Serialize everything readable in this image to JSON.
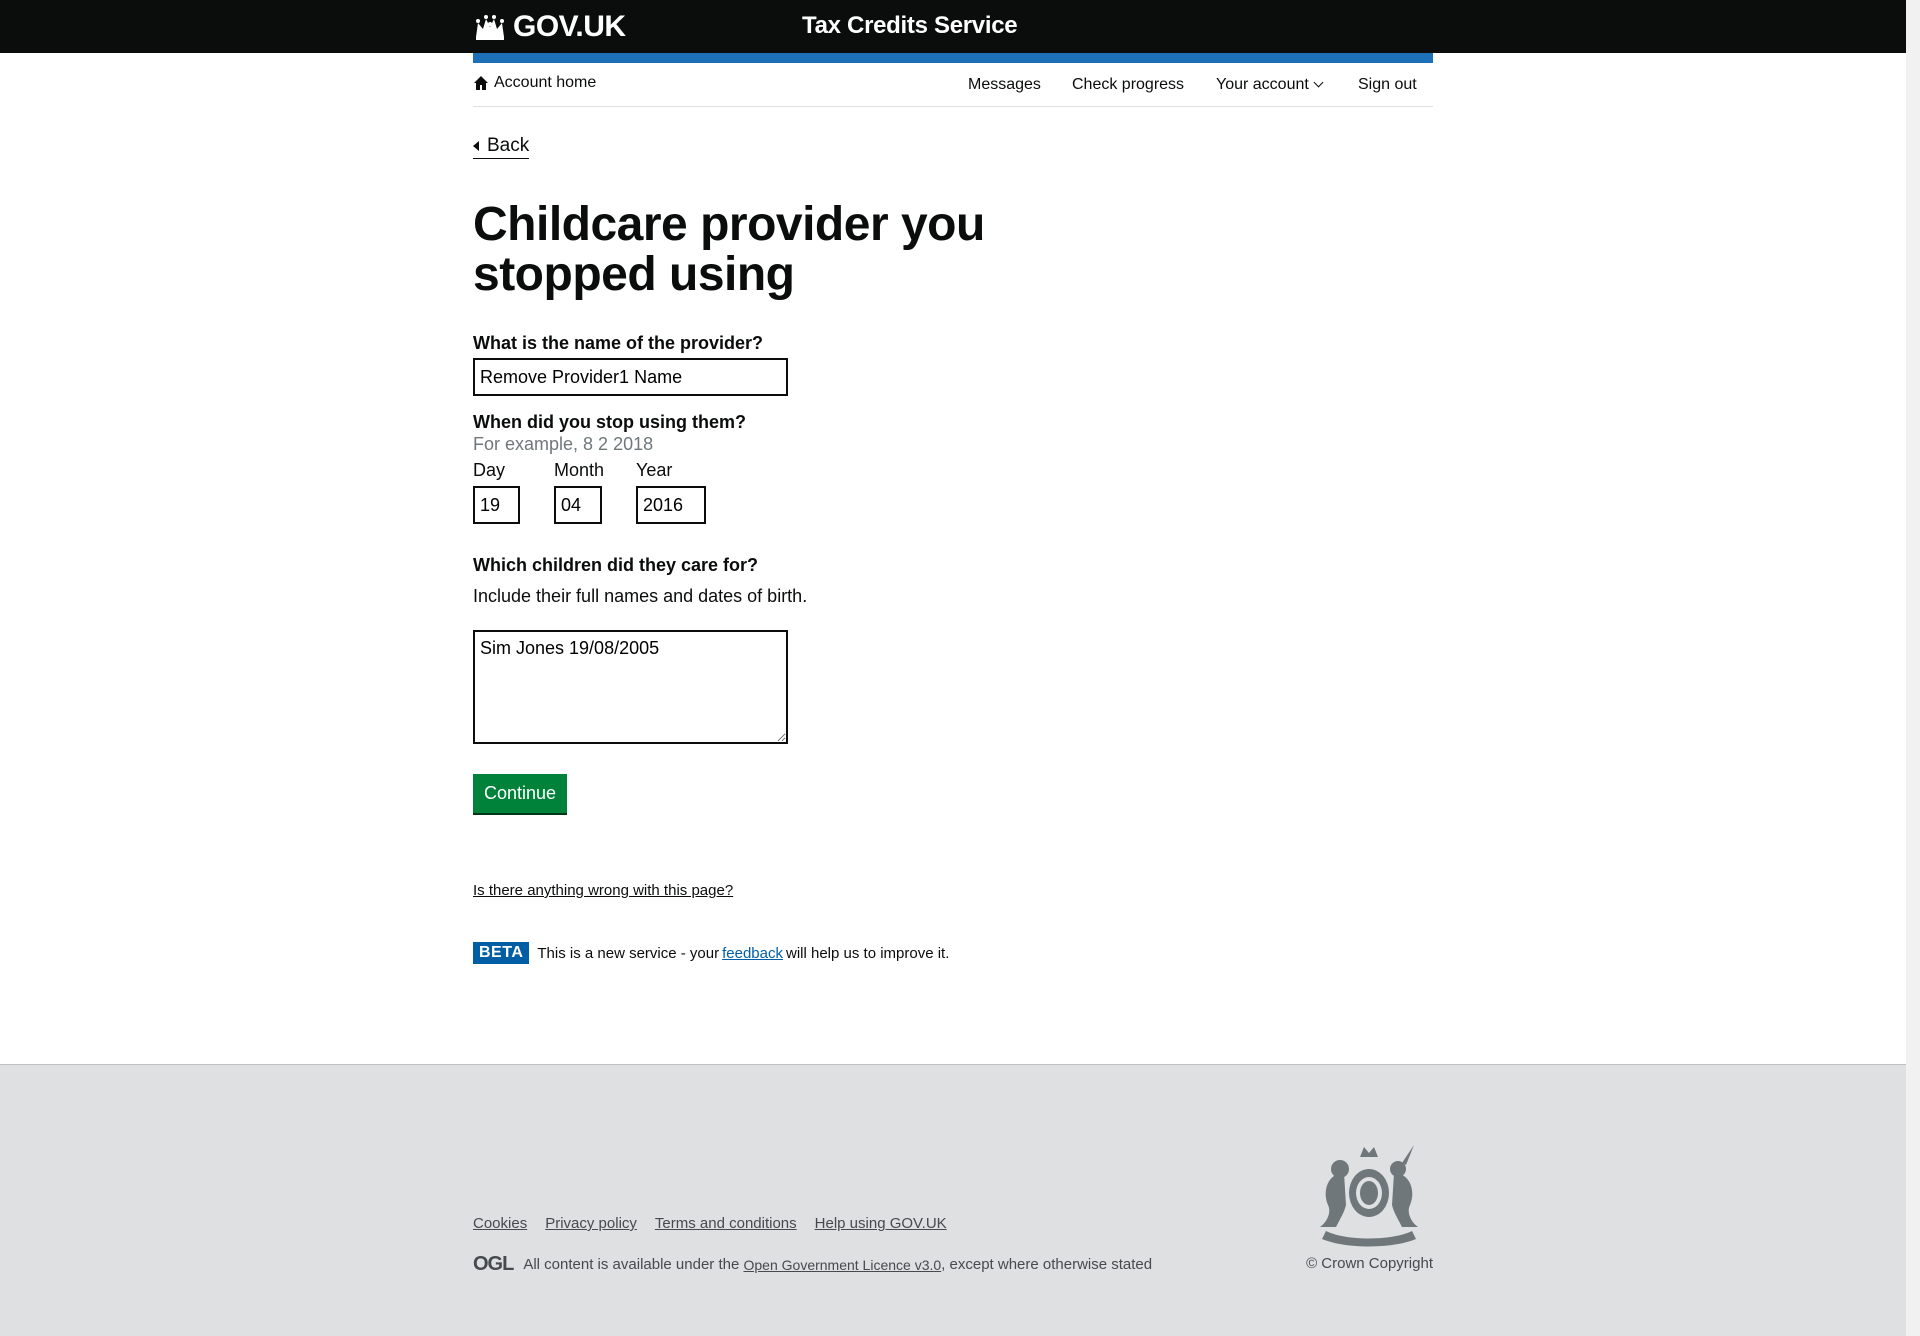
{
  "header": {
    "logo_text": "GOV.UK",
    "service_name": "Tax Credits Service"
  },
  "nav": {
    "home": "Account home",
    "messages": "Messages",
    "check_progress": "Check progress",
    "your_account": "Your account",
    "sign_out": "Sign out"
  },
  "back_label": "Back",
  "page_title": "Childcare provider you stopped using",
  "provider_name": {
    "label": "What is the name of the provider?",
    "value": "Remove Provider1 Name"
  },
  "stop_date": {
    "label": "When did you stop using them?",
    "hint": "For example, 8 2 2018",
    "day_label": "Day",
    "day_value": "19",
    "month_label": "Month",
    "month_value": "04",
    "year_label": "Year",
    "year_value": "2016"
  },
  "children": {
    "label": "Which children did they care for?",
    "hint": "Include their full names and dates of birth.",
    "value": "Sim Jones 19/08/2005"
  },
  "continue_label": "Continue",
  "report_link": "Is there anything wrong with this page?",
  "beta": {
    "tag": "BETA",
    "text_before": "This is a new service  - your",
    "link": "feedback",
    "text_after": "will help us to improve it."
  },
  "footer": {
    "links": [
      "Cookies",
      "Privacy policy",
      "Terms and conditions",
      "Help using GOV.UK"
    ],
    "ogl": "OGL",
    "licence_before": "All content is available under the",
    "licence_link": "Open Government Licence v3.0",
    "licence_after": ", except where otherwise stated",
    "copyright": "© Crown Copyright"
  },
  "colors": {
    "header_bg": "#0b0c0c",
    "accent_blue": "#1d70b8",
    "button_green": "#00823b",
    "beta_blue": "#005ea5",
    "footer_bg": "#dee0e2"
  },
  "icons": [
    "crown-icon",
    "home-icon",
    "chevron-down-icon",
    "back-arrow-icon",
    "royal-crest-icon"
  ]
}
